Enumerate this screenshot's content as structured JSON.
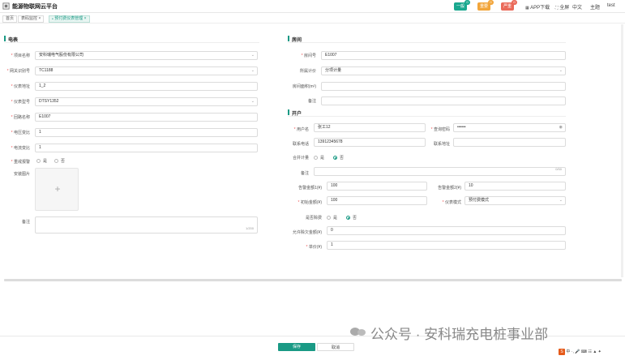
{
  "app": {
    "title": "能源物联网云平台"
  },
  "header": {
    "alarms": [
      {
        "label": "一般",
        "count": "0",
        "color": "#1aa88f",
        "badge_color": "#1aa88f"
      },
      {
        "label": "重要",
        "count": "0",
        "color": "#f2a53a",
        "badge_color": "#f2a53a"
      },
      {
        "label": "严重",
        "count": "0",
        "color": "#ea6a5a",
        "badge_color": "#ea6a5a"
      }
    ],
    "app_download": "APP下载",
    "fullscreen": "全屏",
    "language": "中文",
    "theme": "主题",
    "user": "test"
  },
  "tabs": [
    {
      "label": "首页"
    },
    {
      "label": "表码监控",
      "close": "×"
    },
    {
      "label": "预付费仪表管理",
      "close": "×",
      "dot": "●"
    }
  ],
  "meter": {
    "section_title": "电表",
    "fields": {
      "project": {
        "label": "项目名称",
        "value": "安科瑞电气股份有限公司"
      },
      "gateway": {
        "label": "网关识别号",
        "value": "TC1188"
      },
      "address": {
        "label": "仪表地址",
        "value": "1_2"
      },
      "model": {
        "label": "仪表型号",
        "value": "DTSY1352"
      },
      "loop": {
        "label": "回路名称",
        "value": "E1007"
      },
      "voltage_ratio": {
        "label": "电压变比",
        "value": "1"
      },
      "current_ratio": {
        "label": "电流变比",
        "value": "1"
      },
      "reverse_alarm": {
        "label": "重戒报警",
        "yes": "是",
        "no": "否"
      },
      "photo": {
        "label": "安装图片",
        "plus": "+"
      },
      "remark": {
        "label": "备注",
        "counter": "1/200"
      }
    }
  },
  "room": {
    "section_title": "房间",
    "fields": {
      "room_no": {
        "label": "房间号",
        "value": "E1007"
      },
      "pricing": {
        "label": "所属计价",
        "value": "分项计量"
      },
      "area": {
        "label": "房间面积(m²)",
        "value": ""
      },
      "remark": {
        "label": "备注",
        "value": ""
      }
    }
  },
  "account": {
    "section_title": "开户",
    "fields": {
      "user_name": {
        "label": "用户名",
        "value": "张工12"
      },
      "query_password": {
        "label": "查询密码",
        "value": "••••••"
      },
      "phone": {
        "label": "联系电话",
        "value": "13912345678"
      },
      "contact_address": {
        "label": "联系地址",
        "value": ""
      },
      "combined": {
        "label": "合并计量",
        "yes": "是",
        "no": "否"
      },
      "remark": {
        "label": "备注",
        "counter": "0/50"
      },
      "alarm1": {
        "label": "告警金额1(¥)",
        "value": "100"
      },
      "alarm2": {
        "label": "告警金额2(¥)",
        "value": "10"
      },
      "initial": {
        "label": "初始金额(¥)",
        "value": "100"
      },
      "meter_mode": {
        "label": "仪表模式",
        "value": "预付费模式"
      },
      "overdraft_flag": {
        "label": "是否赊费",
        "yes": "是",
        "no": "否"
      },
      "overdraft": {
        "label": "允许赊欠金额(¥)",
        "value": "0"
      },
      "unit_price": {
        "label": "单价(¥)",
        "value": "1"
      }
    }
  },
  "footer": {
    "save": "保存",
    "cancel": "取消"
  },
  "watermark": "公众号 · 安科瑞充电桩事业部",
  "ime": {
    "logo": "S",
    "text": "中 ·, 🎤 ⌨ ☷ ▲ ✦"
  }
}
